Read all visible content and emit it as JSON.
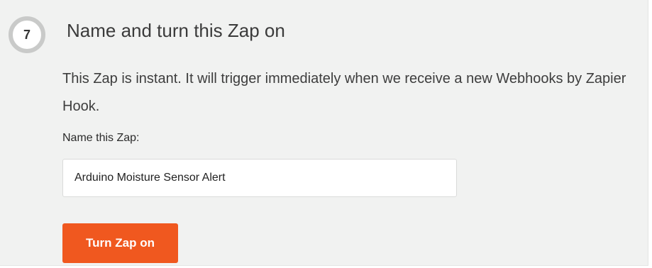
{
  "step": {
    "number": "7",
    "title": "Name and turn this Zap on"
  },
  "description": "This Zap is instant. It will trigger immediately when we receive a new Webhooks by Zapier Hook.",
  "name_field": {
    "label": "Name this Zap:",
    "value": "Arduino Moisture Sensor Alert"
  },
  "turn_on_button": {
    "label": "Turn Zap on"
  },
  "colors": {
    "panel_background": "#f1f2f1",
    "accent": "#f0581f",
    "badge_ring": "#c9cac9"
  }
}
